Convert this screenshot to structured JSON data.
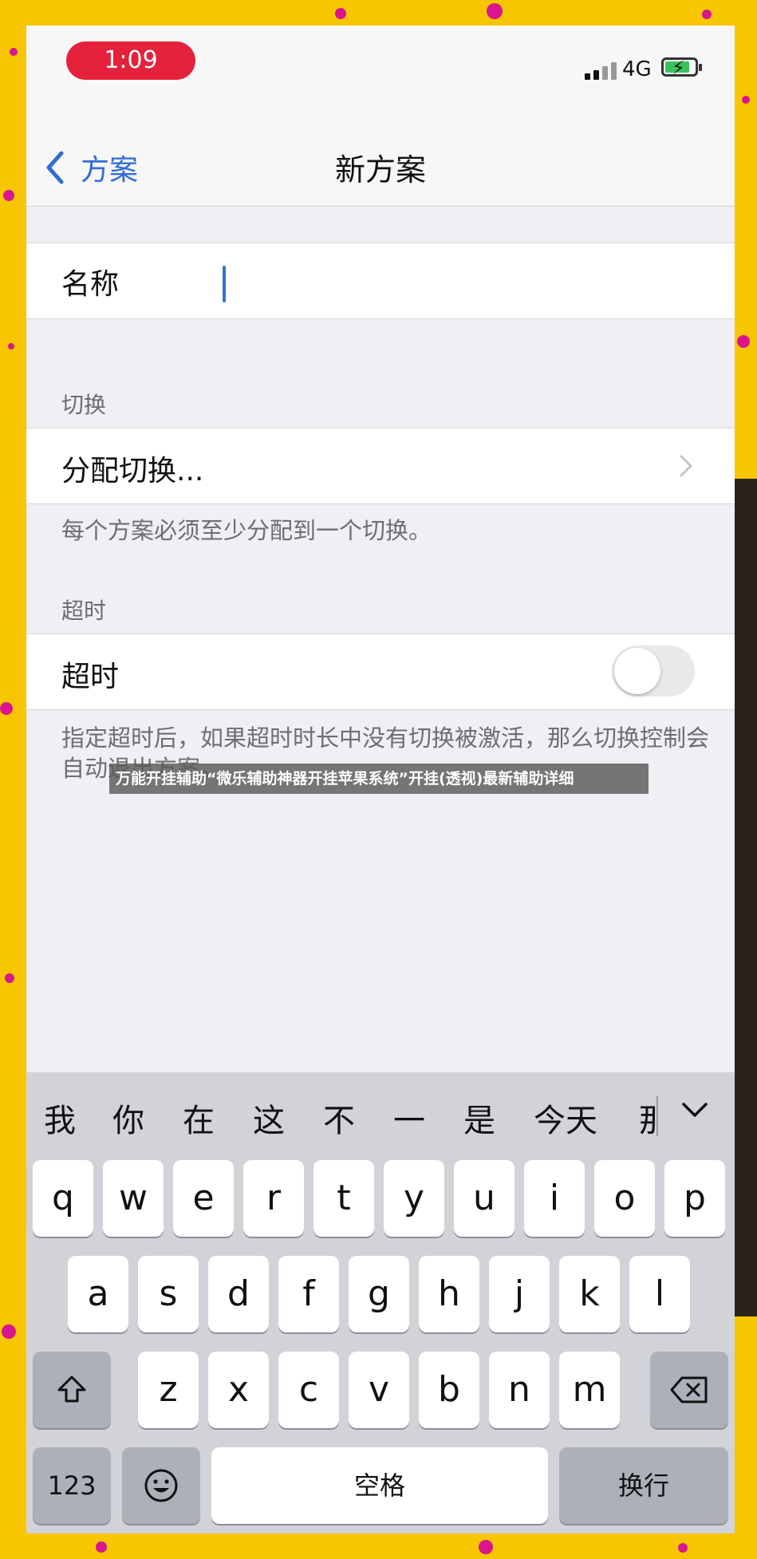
{
  "status_bar": {
    "time": "1:09",
    "network": "4G"
  },
  "nav": {
    "back_label": "方案",
    "title": "新方案"
  },
  "name_field": {
    "label": "名称",
    "value": ""
  },
  "switch_section": {
    "header": "切换",
    "row_label": "分配切换...",
    "footer": "每个方案必须至少分配到一个切换。"
  },
  "timeout_section": {
    "header": "超时",
    "row_label": "超时",
    "toggle_on": false,
    "footer": "指定超时后，如果超时时长中没有切换被激活，那么切换控制会自动退出方案。"
  },
  "overlay_banner": "万能开挂辅助“微乐辅助神器开挂苹果系统”开挂(透视)最新辅助详细",
  "keyboard": {
    "candidates": [
      "我",
      "你",
      "在",
      "这",
      "不",
      "一",
      "是",
      "今天",
      "那"
    ],
    "row1": [
      "q",
      "w",
      "e",
      "r",
      "t",
      "y",
      "u",
      "i",
      "o",
      "p"
    ],
    "row2": [
      "a",
      "s",
      "d",
      "f",
      "g",
      "h",
      "j",
      "k",
      "l"
    ],
    "row3": [
      "z",
      "x",
      "c",
      "v",
      "b",
      "n",
      "m"
    ],
    "numbers_key": "123",
    "space_key": "空格",
    "return_key": "换行"
  },
  "colors": {
    "accent": "#2f6bd8",
    "time_pill": "#e5213b",
    "background_frame": "#f7c600",
    "frame_dots": "#d9158f"
  }
}
